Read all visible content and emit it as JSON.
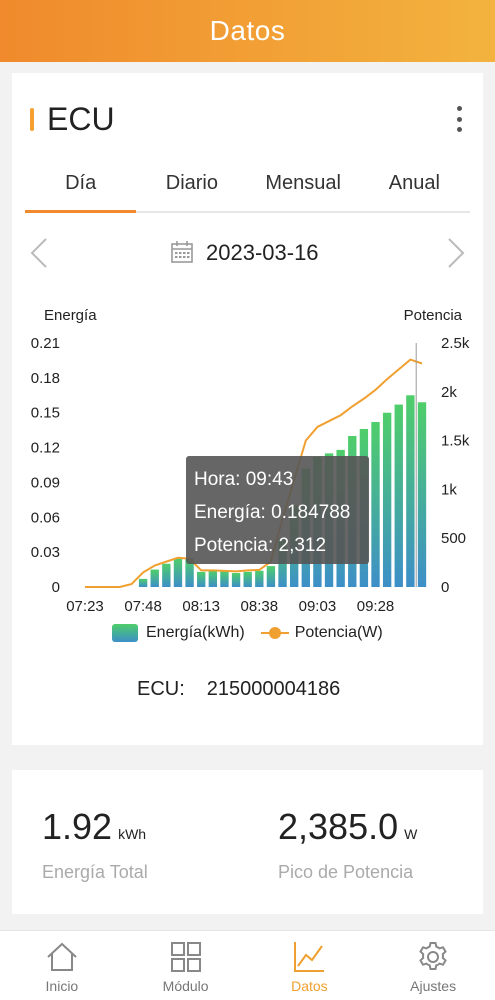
{
  "header": {
    "title": "Datos"
  },
  "ecu": {
    "title": "ECU",
    "menu_icon": "more-vertical-icon"
  },
  "tabs": [
    {
      "label": "Día",
      "active": true
    },
    {
      "label": "Diario",
      "active": false
    },
    {
      "label": "Mensual",
      "active": false
    },
    {
      "label": "Anual",
      "active": false
    }
  ],
  "date_nav": {
    "date": "2023-03-16",
    "prev_icon": "chevron-left-icon",
    "next_icon": "chevron-right-icon",
    "calendar_icon": "calendar-icon"
  },
  "chart_data": {
    "type": "bar",
    "left_axis_label": "Energía",
    "right_axis_label": "Potencia",
    "left_ticks": [
      "0",
      "0.03",
      "0.06",
      "0.09",
      "0.12",
      "0.15",
      "0.18",
      "0.21"
    ],
    "right_ticks": [
      "0",
      "500",
      "1k",
      "1.5k",
      "2k",
      "2.5k"
    ],
    "x_ticks": [
      "07:23",
      "07:48",
      "08:13",
      "08:38",
      "09:03",
      "09:28"
    ],
    "ylim_left": [
      0,
      0.21
    ],
    "ylim_right": [
      0,
      2500
    ],
    "times": [
      "07:23",
      "07:28",
      "07:33",
      "07:38",
      "07:43",
      "07:48",
      "07:53",
      "07:58",
      "08:03",
      "08:08",
      "08:13",
      "08:18",
      "08:23",
      "08:28",
      "08:33",
      "08:38",
      "08:43",
      "08:48",
      "08:53",
      "08:58",
      "09:03",
      "09:08",
      "09:13",
      "09:18",
      "09:23",
      "09:28",
      "09:33",
      "09:38",
      "09:43",
      "09:48"
    ],
    "series": [
      {
        "name": "Energía(kWh)",
        "values": [
          0,
          0,
          0,
          0,
          0,
          0.007,
          0.015,
          0.02,
          0.025,
          0.025,
          0.013,
          0.014,
          0.014,
          0.012,
          0.013,
          0.014,
          0.018,
          0.042,
          0.07,
          0.102,
          0.112,
          0.115,
          0.118,
          0.13,
          0.136,
          0.142,
          0.15,
          0.157,
          0.165,
          0.159
        ]
      },
      {
        "name": "Potencia(W)",
        "values": [
          0,
          0,
          0,
          0,
          30,
          150,
          220,
          260,
          300,
          290,
          170,
          170,
          165,
          160,
          170,
          175,
          260,
          700,
          1100,
          1500,
          1640,
          1700,
          1760,
          1850,
          1930,
          2020,
          2130,
          2230,
          2330,
          2290
        ]
      }
    ],
    "tooltip": {
      "hora": "Hora: 09:43",
      "energia": "Energía: 0.184788",
      "potencia": "Potencia: 2,312"
    },
    "legend": {
      "energy": "Energía(kWh)",
      "power": "Potencia(W)"
    },
    "colors": {
      "bar_top": "#4fce6a",
      "bar_bottom": "#3d8fc8",
      "line": "#f0a030"
    }
  },
  "serial": {
    "label": "ECU:",
    "value": "215000004186"
  },
  "stats": {
    "energy_value": "1.92",
    "energy_unit": "kWh",
    "energy_label": "Energía Total",
    "peak_value": "2,385.0",
    "peak_unit": "W",
    "peak_label": "Pico de Potencia"
  },
  "bottom_nav": [
    {
      "label": "Inicio",
      "icon": "home-icon",
      "active": false
    },
    {
      "label": "Módulo",
      "icon": "grid-icon",
      "active": false
    },
    {
      "label": "Datos",
      "icon": "chart-icon",
      "active": true
    },
    {
      "label": "Ajustes",
      "icon": "gear-icon",
      "active": false
    }
  ]
}
